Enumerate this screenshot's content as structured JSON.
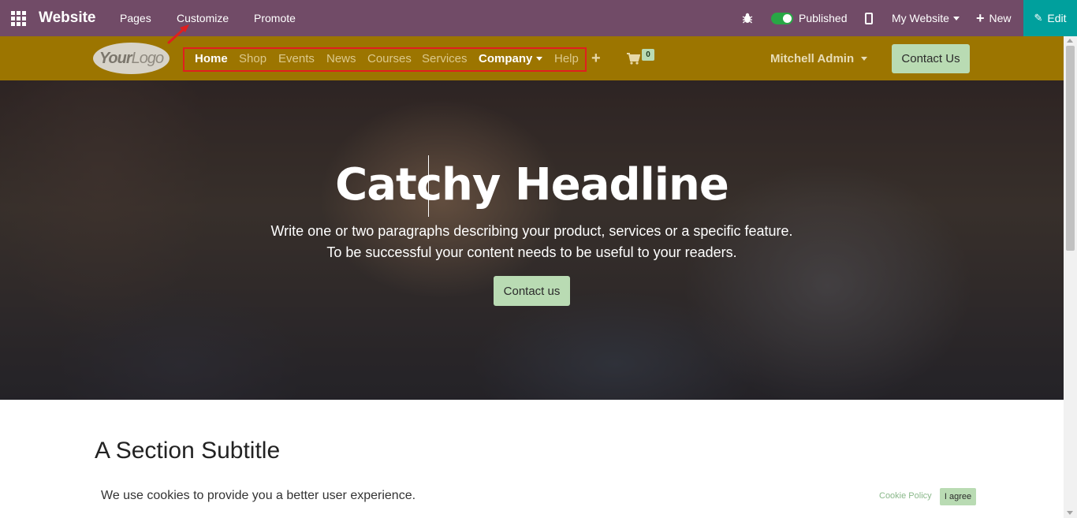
{
  "admin_bar": {
    "app_title": "Website",
    "menu": [
      "Pages",
      "Customize",
      "Promote"
    ],
    "published_label": "Published",
    "published": true,
    "website_switcher": "My Website",
    "new_label": "New",
    "edit_label": "Edit",
    "bg_color": "#714B67",
    "edit_color": "#00A09D"
  },
  "header": {
    "logo_text_bold": "Your",
    "logo_text": "Logo",
    "nav": [
      "Home",
      "Shop",
      "Events",
      "News",
      "Courses",
      "Services",
      "Company",
      "Help"
    ],
    "active_nav": "Home",
    "cart_count": "0",
    "user_name": "Mitchell Admin",
    "contact_label": "Contact Us",
    "bg_color": "#9C7500",
    "accent_button_color": "#B9DBB3"
  },
  "hero": {
    "title": "Catchy Headline",
    "text_line_1": "Write one or two paragraphs describing your product, services or a specific feature.",
    "text_line_2": "To be successful your content needs to be useful to your readers.",
    "button_label": "Contact us"
  },
  "section": {
    "subtitle": "A Section Subtitle"
  },
  "cookie_bar": {
    "message": "We use cookies to provide you a better user experience.",
    "policy_link": "Cookie Policy",
    "agree_label": "I agree"
  },
  "annotation": {
    "highlight_color": "#E01F1F"
  }
}
